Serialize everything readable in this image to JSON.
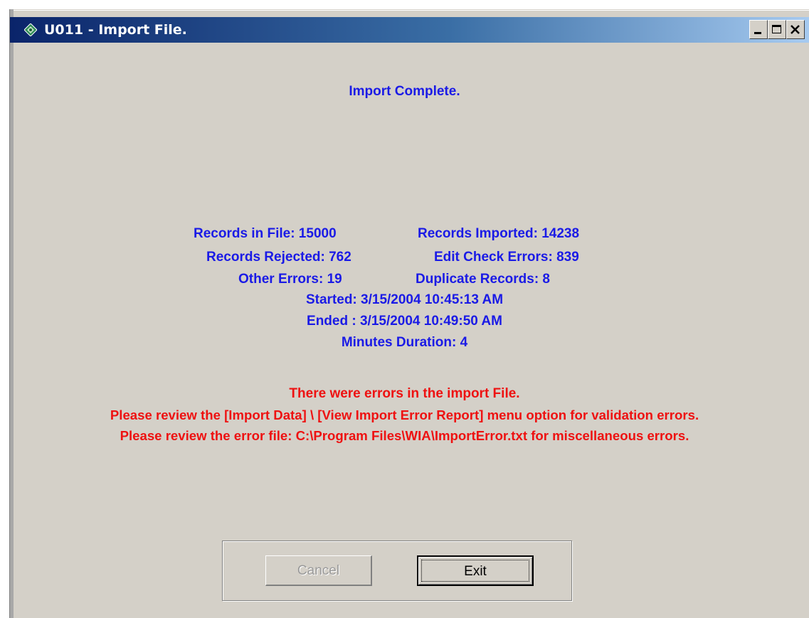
{
  "window": {
    "title": "U011 - Import File.",
    "controls": {
      "minimize": "minimize-button",
      "maximize": "maximize-button",
      "close": "close-button"
    }
  },
  "status": {
    "heading": "Import Complete."
  },
  "stats": {
    "records_in_file": "Records in File: 15000",
    "records_imported": "Records Imported: 14238",
    "records_rejected": "Records Rejected: 762",
    "edit_check_errors": "Edit Check Errors: 839",
    "other_errors": "Other Errors: 19",
    "duplicate_records": "Duplicate Records: 8",
    "started": "Started: 3/15/2004 10:45:13 AM",
    "ended": "Ended : 3/15/2004 10:49:50 AM",
    "duration": "Minutes Duration: 4"
  },
  "errors": {
    "line1": "There were errors in the import File.",
    "line2": "Please review the [Import Data] \\ [View Import Error Report] menu option for validation errors.",
    "line3": "Please review the error file: C:\\Program Files\\WIA\\ImportError.txt for miscellaneous errors."
  },
  "buttons": {
    "cancel_label": "Cancel",
    "exit_label": "Exit"
  },
  "colors": {
    "title_gradient_start": "#0a246a",
    "title_gradient_end": "#a6caf0",
    "stats_text": "#1a1ae6",
    "error_text": "#ee1111",
    "window_background": "#d4d0c8"
  },
  "icons": {
    "app": "app-diamond-icon",
    "minimize": "minimize-icon",
    "maximize": "maximize-icon",
    "close": "close-icon"
  }
}
